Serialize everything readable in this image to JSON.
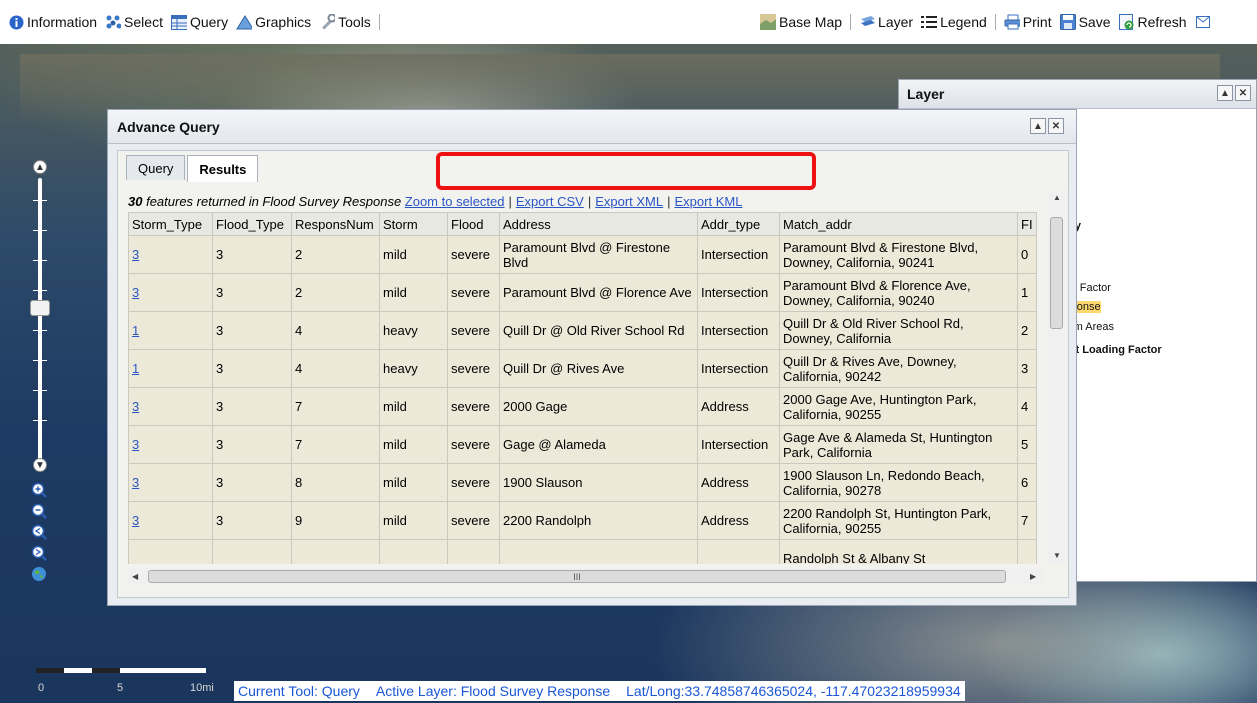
{
  "toolbar": {
    "left": [
      {
        "label": "Information",
        "icon": "info-icon"
      },
      {
        "label": "Select",
        "icon": "select-icon"
      },
      {
        "label": "Query",
        "icon": "query-icon"
      },
      {
        "label": "Graphics",
        "icon": "graphics-icon"
      },
      {
        "label": "Tools",
        "icon": "tools-icon"
      }
    ],
    "right": [
      {
        "label": "Base Map",
        "icon": "basemap-icon"
      },
      {
        "label": "Layer",
        "icon": "layer-icon"
      },
      {
        "label": "Legend",
        "icon": "legend-icon"
      },
      {
        "label": "Print",
        "icon": "print-icon"
      },
      {
        "label": "Save",
        "icon": "save-icon"
      },
      {
        "label": "Refresh",
        "icon": "refresh-icon"
      }
    ]
  },
  "advance_query": {
    "title": "Advance Query",
    "tabs": [
      "Query",
      "Results"
    ],
    "active_tab": "Results",
    "summary_count": "30",
    "summary_text": " features returned in Flood Survey Response ",
    "links": [
      "Zoom to selected",
      "Export CSV",
      "Export XML",
      "Export KML"
    ],
    "columns": [
      "Storm_Type",
      "Flood_Type",
      "ResponsNum",
      "Storm",
      "Flood",
      "Address",
      "Addr_type",
      "Match_addr",
      "FI"
    ],
    "rows": [
      [
        "3",
        "3",
        "2",
        "mild",
        "severe",
        "Paramount Blvd @ Firestone Blvd",
        "Intersection",
        "Paramount Blvd & Firestone Blvd, Downey, California, 90241",
        "0"
      ],
      [
        "3",
        "3",
        "2",
        "mild",
        "severe",
        "Paramount Blvd @ Florence Ave",
        "Intersection",
        "Paramount Blvd & Florence Ave, Downey, California, 90240",
        "1"
      ],
      [
        "1",
        "3",
        "4",
        "heavy",
        "severe",
        "Quill Dr @ Old River School Rd",
        "Intersection",
        "Quill Dr & Old River School Rd, Downey, California",
        "2"
      ],
      [
        "1",
        "3",
        "4",
        "heavy",
        "severe",
        "Quill Dr @ Rives Ave",
        "Intersection",
        "Quill Dr & Rives Ave, Downey, California, 90242",
        "3"
      ],
      [
        "3",
        "3",
        "7",
        "mild",
        "severe",
        "2000 Gage",
        "Address",
        "2000 Gage Ave, Huntington Park, California, 90255",
        "4"
      ],
      [
        "3",
        "3",
        "7",
        "mild",
        "severe",
        "Gage @ Alameda",
        "Intersection",
        "Gage Ave & Alameda St, Huntington Park, California",
        "5"
      ],
      [
        "3",
        "3",
        "8",
        "mild",
        "severe",
        "1900 Slauson",
        "Address",
        "1900 Slauson Ln, Redondo Beach, California, 90278",
        "6"
      ],
      [
        "3",
        "3",
        "9",
        "mild",
        "severe",
        "2200 Randolph",
        "Address",
        "2200 Randolph St, Huntington Park, California, 90255",
        "7"
      ],
      [
        "",
        "",
        "",
        "",
        "",
        "",
        "",
        "Randolph St & Albany St",
        ""
      ]
    ],
    "hscroll_grip": "III"
  },
  "layer_panel": {
    "title": "Layer",
    "fragments": [
      {
        "text": "ary",
        "bold": false,
        "highlight": false
      },
      {
        "text": "ality",
        "bold": true,
        "highlight": false
      },
      {
        "text": "s",
        "bold": false,
        "highlight": false
      },
      {
        "text": "eas",
        "bold": false,
        "highlight": false
      },
      {
        "text": "tion Factor",
        "bold": false,
        "highlight": false
      },
      {
        "text": "esponse",
        "bold": false,
        "highlight": true
      },
      {
        "text": "olem Areas",
        "bold": false,
        "highlight": false
      },
      {
        "text": "tant Loading Factor",
        "bold": true,
        "highlight": false
      }
    ]
  },
  "scale": {
    "labels": [
      "0",
      "5",
      "10mi"
    ]
  },
  "status": {
    "tool": "Current Tool: Query",
    "layer": "Active Layer: Flood Survey Response",
    "latlong": "Lat/Long:33.74858746365024, -117.47023218959934"
  },
  "colors": {
    "link": "#2a55c4",
    "highlight_box": "#ee1111",
    "row_bg": "#ece9d8",
    "layer_highlight": "#ffd870"
  }
}
